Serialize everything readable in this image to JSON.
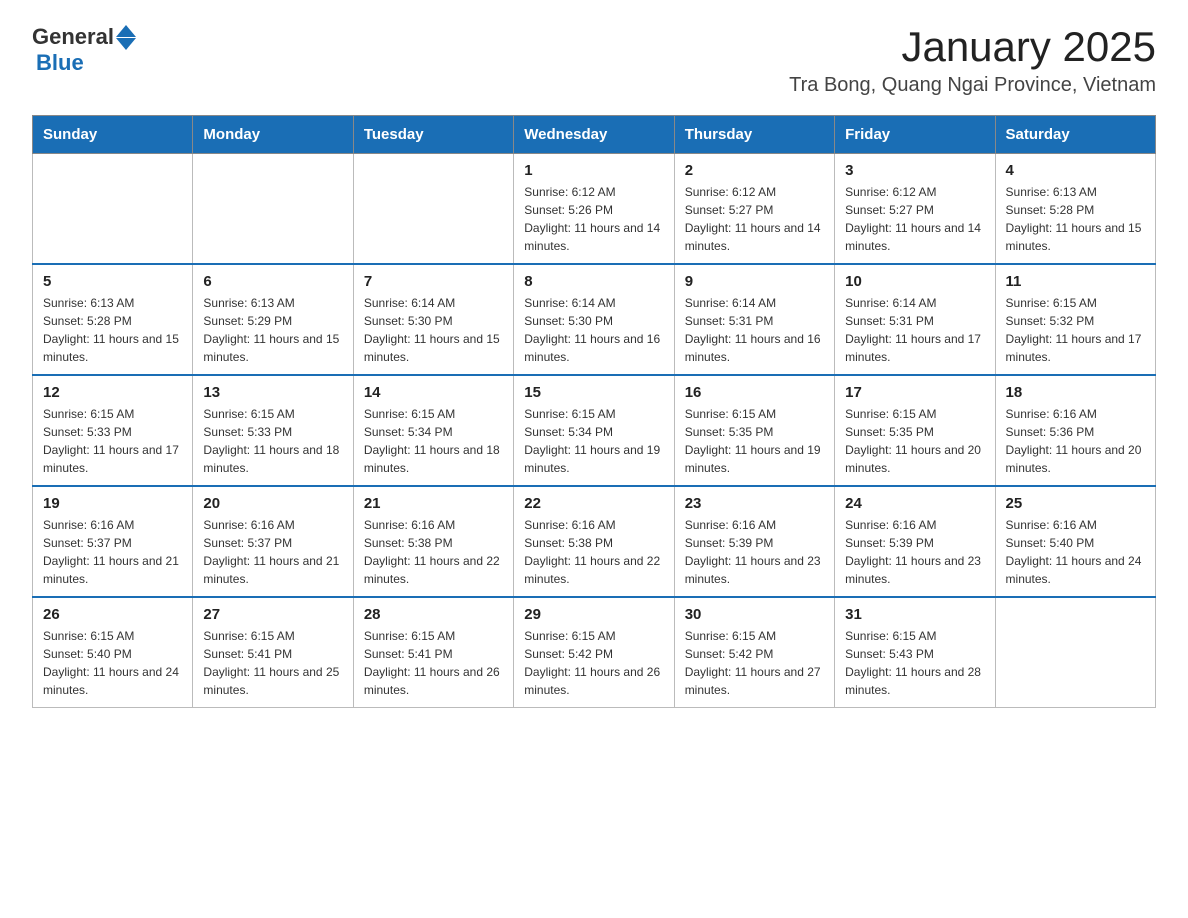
{
  "header": {
    "logo_general": "General",
    "logo_blue": "Blue",
    "title": "January 2025",
    "subtitle": "Tra Bong, Quang Ngai Province, Vietnam"
  },
  "weekdays": [
    "Sunday",
    "Monday",
    "Tuesday",
    "Wednesday",
    "Thursday",
    "Friday",
    "Saturday"
  ],
  "weeks": [
    [
      {
        "day": "",
        "info": ""
      },
      {
        "day": "",
        "info": ""
      },
      {
        "day": "",
        "info": ""
      },
      {
        "day": "1",
        "info": "Sunrise: 6:12 AM\nSunset: 5:26 PM\nDaylight: 11 hours and 14 minutes."
      },
      {
        "day": "2",
        "info": "Sunrise: 6:12 AM\nSunset: 5:27 PM\nDaylight: 11 hours and 14 minutes."
      },
      {
        "day": "3",
        "info": "Sunrise: 6:12 AM\nSunset: 5:27 PM\nDaylight: 11 hours and 14 minutes."
      },
      {
        "day": "4",
        "info": "Sunrise: 6:13 AM\nSunset: 5:28 PM\nDaylight: 11 hours and 15 minutes."
      }
    ],
    [
      {
        "day": "5",
        "info": "Sunrise: 6:13 AM\nSunset: 5:28 PM\nDaylight: 11 hours and 15 minutes."
      },
      {
        "day": "6",
        "info": "Sunrise: 6:13 AM\nSunset: 5:29 PM\nDaylight: 11 hours and 15 minutes."
      },
      {
        "day": "7",
        "info": "Sunrise: 6:14 AM\nSunset: 5:30 PM\nDaylight: 11 hours and 15 minutes."
      },
      {
        "day": "8",
        "info": "Sunrise: 6:14 AM\nSunset: 5:30 PM\nDaylight: 11 hours and 16 minutes."
      },
      {
        "day": "9",
        "info": "Sunrise: 6:14 AM\nSunset: 5:31 PM\nDaylight: 11 hours and 16 minutes."
      },
      {
        "day": "10",
        "info": "Sunrise: 6:14 AM\nSunset: 5:31 PM\nDaylight: 11 hours and 17 minutes."
      },
      {
        "day": "11",
        "info": "Sunrise: 6:15 AM\nSunset: 5:32 PM\nDaylight: 11 hours and 17 minutes."
      }
    ],
    [
      {
        "day": "12",
        "info": "Sunrise: 6:15 AM\nSunset: 5:33 PM\nDaylight: 11 hours and 17 minutes."
      },
      {
        "day": "13",
        "info": "Sunrise: 6:15 AM\nSunset: 5:33 PM\nDaylight: 11 hours and 18 minutes."
      },
      {
        "day": "14",
        "info": "Sunrise: 6:15 AM\nSunset: 5:34 PM\nDaylight: 11 hours and 18 minutes."
      },
      {
        "day": "15",
        "info": "Sunrise: 6:15 AM\nSunset: 5:34 PM\nDaylight: 11 hours and 19 minutes."
      },
      {
        "day": "16",
        "info": "Sunrise: 6:15 AM\nSunset: 5:35 PM\nDaylight: 11 hours and 19 minutes."
      },
      {
        "day": "17",
        "info": "Sunrise: 6:15 AM\nSunset: 5:35 PM\nDaylight: 11 hours and 20 minutes."
      },
      {
        "day": "18",
        "info": "Sunrise: 6:16 AM\nSunset: 5:36 PM\nDaylight: 11 hours and 20 minutes."
      }
    ],
    [
      {
        "day": "19",
        "info": "Sunrise: 6:16 AM\nSunset: 5:37 PM\nDaylight: 11 hours and 21 minutes."
      },
      {
        "day": "20",
        "info": "Sunrise: 6:16 AM\nSunset: 5:37 PM\nDaylight: 11 hours and 21 minutes."
      },
      {
        "day": "21",
        "info": "Sunrise: 6:16 AM\nSunset: 5:38 PM\nDaylight: 11 hours and 22 minutes."
      },
      {
        "day": "22",
        "info": "Sunrise: 6:16 AM\nSunset: 5:38 PM\nDaylight: 11 hours and 22 minutes."
      },
      {
        "day": "23",
        "info": "Sunrise: 6:16 AM\nSunset: 5:39 PM\nDaylight: 11 hours and 23 minutes."
      },
      {
        "day": "24",
        "info": "Sunrise: 6:16 AM\nSunset: 5:39 PM\nDaylight: 11 hours and 23 minutes."
      },
      {
        "day": "25",
        "info": "Sunrise: 6:16 AM\nSunset: 5:40 PM\nDaylight: 11 hours and 24 minutes."
      }
    ],
    [
      {
        "day": "26",
        "info": "Sunrise: 6:15 AM\nSunset: 5:40 PM\nDaylight: 11 hours and 24 minutes."
      },
      {
        "day": "27",
        "info": "Sunrise: 6:15 AM\nSunset: 5:41 PM\nDaylight: 11 hours and 25 minutes."
      },
      {
        "day": "28",
        "info": "Sunrise: 6:15 AM\nSunset: 5:41 PM\nDaylight: 11 hours and 26 minutes."
      },
      {
        "day": "29",
        "info": "Sunrise: 6:15 AM\nSunset: 5:42 PM\nDaylight: 11 hours and 26 minutes."
      },
      {
        "day": "30",
        "info": "Sunrise: 6:15 AM\nSunset: 5:42 PM\nDaylight: 11 hours and 27 minutes."
      },
      {
        "day": "31",
        "info": "Sunrise: 6:15 AM\nSunset: 5:43 PM\nDaylight: 11 hours and 28 minutes."
      },
      {
        "day": "",
        "info": ""
      }
    ]
  ]
}
